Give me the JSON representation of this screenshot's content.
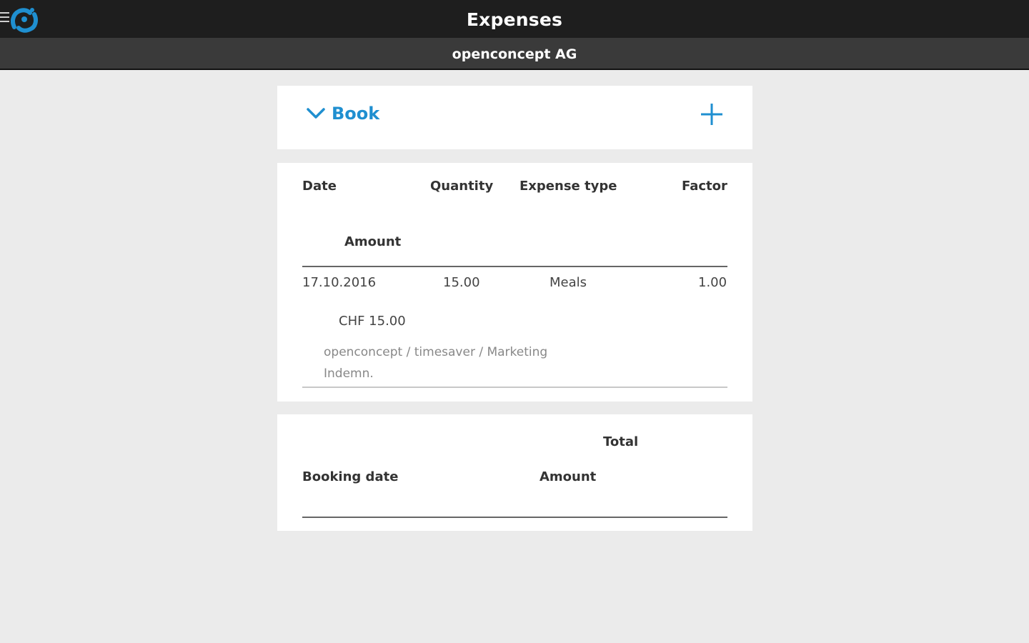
{
  "header": {
    "title": "Expenses",
    "company": "openconcept AG",
    "logo_color": "#1f8fd0"
  },
  "book_section": {
    "label": "Book",
    "accent": "#1f8fd0"
  },
  "expense_table": {
    "columns": {
      "date": "Date",
      "quantity": "Quantity",
      "expense_type": "Expense type",
      "factor": "Factor",
      "amount": "Amount"
    },
    "rows": [
      {
        "date": "17.10.2016",
        "quantity": "15.00",
        "expense_type": "Meals",
        "factor": "1.00",
        "amount": "CHF 15.00",
        "project": "openconcept / timesaver / Marketing",
        "note": "Indemn."
      }
    ]
  },
  "totals_table": {
    "columns": {
      "booking_date": "Booking date",
      "total": "Total",
      "amount": "Amount"
    }
  }
}
